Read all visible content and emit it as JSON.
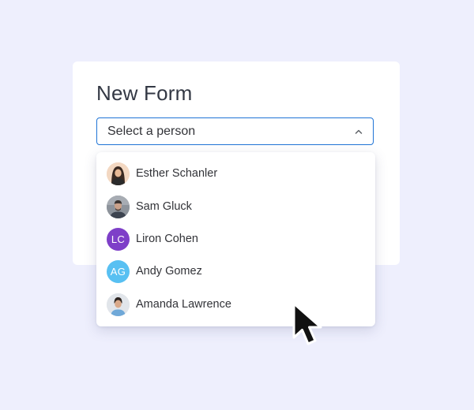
{
  "form": {
    "title": "New Form"
  },
  "select": {
    "placeholder": "Select a person",
    "state": "open"
  },
  "options": [
    {
      "name": "Esther Schanler",
      "avatar_type": "photo",
      "avatar_bg": "#f3d8c2"
    },
    {
      "name": "Sam Gluck",
      "avatar_type": "photo",
      "avatar_bg": "#9aa0a8"
    },
    {
      "name": "Liron Cohen",
      "avatar_type": "initials",
      "initials": "LC",
      "avatar_bg": "#7e3fc8"
    },
    {
      "name": "Andy Gomez",
      "avatar_type": "initials",
      "initials": "AG",
      "avatar_bg": "#58c0f2"
    },
    {
      "name": "Amanda Lawrence",
      "avatar_type": "photo",
      "avatar_bg": "#e1e5ea"
    }
  ],
  "colors": {
    "background": "#eeeffd",
    "accent_border": "#1f74d6",
    "text": "#323338"
  }
}
